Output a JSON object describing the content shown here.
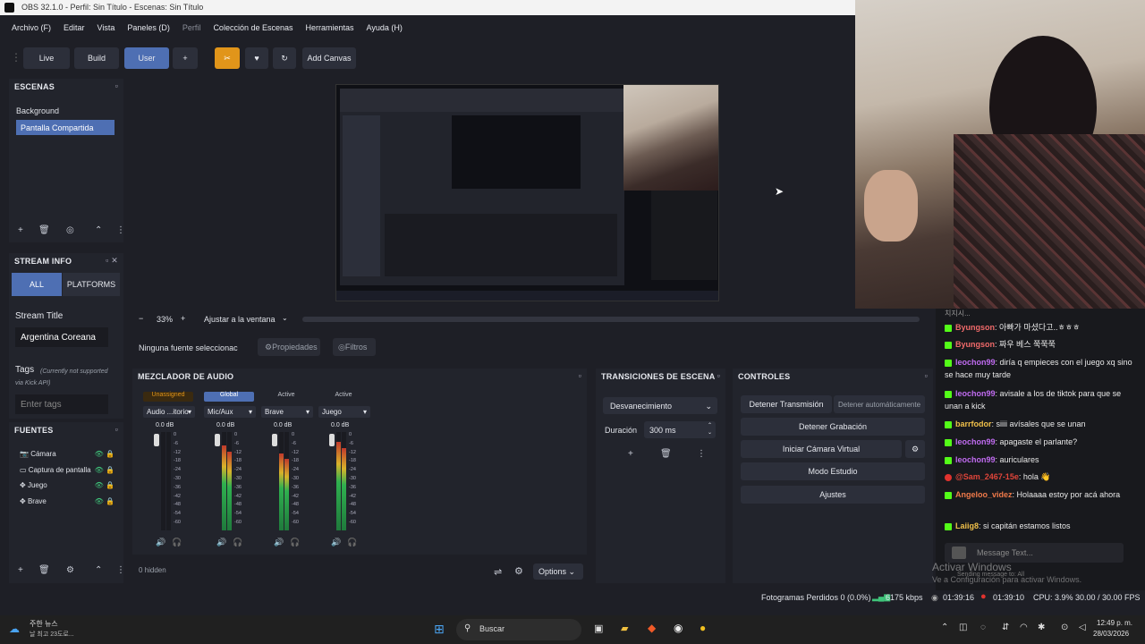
{
  "titlebar": {
    "title": "OBS 32.1.0 - Perfil: Sin Título - Escenas: Sin Título"
  },
  "menu": [
    "Archivo (F)",
    "Editar",
    "Vista",
    "Paneles (D)",
    "Perfil",
    "Colección de Escenas",
    "Herramientas",
    "Ayuda (H)"
  ],
  "toolbar": {
    "live": "Live",
    "build": "Build",
    "user": "User",
    "plus": "+",
    "add_canvas": "Add Canvas"
  },
  "scenes": {
    "title": "ESCENAS",
    "items": [
      "Background",
      "Pantalla Compartida"
    ],
    "selected": 1
  },
  "stream_info": {
    "title": "STREAM INFO",
    "tab_all": "ALL",
    "tab_platforms": "PLATFORMS",
    "stream_title_label": "Stream Title",
    "stream_title_value": "Argentina Coreana",
    "tags_label": "Tags",
    "tags_note": "(Currently not supported via Kick API)",
    "tags_placeholder": "Enter tags"
  },
  "sources": {
    "title": "FUENTES",
    "items": [
      "Cámara",
      "Captura de pantalla",
      "Juego",
      "Brave"
    ]
  },
  "preview_bar": {
    "minus": "−",
    "zoom": "33%",
    "plus": "+",
    "fit": "Ajustar a la ventana"
  },
  "source_bar": {
    "no_source": "Ninguna fuente seleccionac",
    "properties": "Propiedades",
    "filters": "Filtros"
  },
  "mixer": {
    "title": "MEZCLADOR DE AUDIO",
    "channels": [
      {
        "label": "Unassigned",
        "name": "Audio ...itorio",
        "db": "0.0 dB",
        "level": 0.0
      },
      {
        "label": "Global",
        "name": "Mic/Aux",
        "db": "0.0 dB",
        "level": 0.86
      },
      {
        "label": "Active",
        "name": "Brave",
        "db": "0.0 dB",
        "level": 0.78
      },
      {
        "label": "Active",
        "name": "Juego",
        "db": "0.0 dB",
        "level": 0.9
      }
    ],
    "ticks": [
      "0",
      "-6",
      "-12",
      "-18",
      "-24",
      "-30",
      "-36",
      "-42",
      "-48",
      "-54",
      "-60"
    ],
    "hidden": "0 hidden",
    "options": "Options"
  },
  "transitions": {
    "title": "TRANSICIONES DE ESCENA",
    "type": "Desvanecimiento",
    "duration_label": "Duración",
    "duration_value": "300 ms"
  },
  "controls": {
    "title": "CONTROLES",
    "stop_stream": "Detener Transmisión",
    "stop_auto": "Detener automáticamente",
    "stop_record": "Detener Grabación",
    "virtual_cam": "Iniciar Cámara Virtual",
    "studio": "Modo Estudio",
    "settings": "Ajustes"
  },
  "chat": {
    "top": "치지시...",
    "messages": [
      {
        "user": "Byungson",
        "text": ": 아빠가 마셨다고..ㅎㅎㅎ",
        "color": "#f06a6a"
      },
      {
        "user": "Byungson",
        "text": ": 짜우 베스 쭉쭉쭉",
        "color": "#f06a6a"
      },
      {
        "user": "leochon99",
        "text": ": diría q empieces con el juego xq sino se hace muy tarde",
        "color": "#c06bf0"
      },
      {
        "user": "leochon99",
        "text": ": avisale a los de tiktok para que se unan a kick",
        "color": "#c06bf0"
      },
      {
        "user": "barrfodor",
        "text": ": siiii avísales que se unan",
        "color": "#f0c04a"
      },
      {
        "user": "leochon99",
        "text": ": apagaste el parlante?",
        "color": "#c06bf0"
      },
      {
        "user": "leochon99",
        "text": ": auriculares",
        "color": "#c06bf0"
      },
      {
        "user": "@Sam_2467-15e",
        "text": ": hola 👋",
        "color": "#e0453a"
      },
      {
        "user": "Angeloo_videz",
        "text": ": Holaaaa estoy por acá ahora",
        "color": "#f07a4a"
      },
      {
        "user": "Laiig8",
        "text": ": si capitán estamos listos",
        "color": "#f0c04a"
      }
    ],
    "placeholder": "Message Text...",
    "sending": "Sending message to: All"
  },
  "watermark": {
    "line1": "Activar Windows",
    "line2": "Ve a Configuración para activar Windows."
  },
  "status": {
    "dropped": "Fotogramas Perdidos 0 (0.0%)",
    "kbps": "6175 kbps",
    "stream_time": "01:39:16",
    "rec_time": "01:39:10",
    "cpu": "CPU: 3.9%",
    "fps": "30.00 / 30.00 FPS"
  },
  "taskbar": {
    "weather1": "주한 뉴스",
    "weather2": "날 최고 23도로...",
    "search": "Buscar",
    "time": "12:49 p. m.",
    "date": "28/03/2026"
  }
}
